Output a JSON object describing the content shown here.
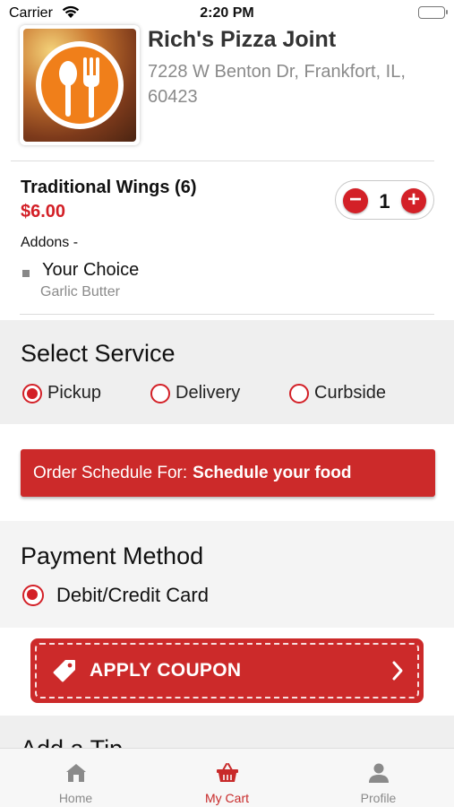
{
  "status_bar": {
    "carrier": "Carrier",
    "time": "2:20 PM"
  },
  "restaurant": {
    "name": "Rich's Pizza Joint",
    "address": "7228 W Benton Dr, Frankfort, IL, 60423",
    "logo_icon": "fork-spoon-icon"
  },
  "cart_item": {
    "name": "Traditional Wings (6)",
    "price": "$6.00",
    "quantity": "1",
    "addons_label": "Addons -",
    "addons": [
      {
        "name": "Your Choice",
        "value": "Garlic Butter"
      }
    ]
  },
  "service": {
    "title": "Select Service",
    "options": [
      {
        "label": "Pickup",
        "selected": true
      },
      {
        "label": "Delivery",
        "selected": false
      },
      {
        "label": "Curbside",
        "selected": false
      }
    ]
  },
  "schedule": {
    "prefix": "Order Schedule For:",
    "value": "Schedule your food"
  },
  "payment": {
    "title": "Payment Method",
    "options": [
      {
        "label": "Debit/Credit Card",
        "selected": true
      }
    ]
  },
  "coupon": {
    "label": "APPLY COUPON"
  },
  "tip": {
    "title": "Add a Tip"
  },
  "tabbar": {
    "tabs": [
      {
        "label": "Home",
        "icon": "home-icon",
        "active": false
      },
      {
        "label": "My Cart",
        "icon": "basket-icon",
        "active": true
      },
      {
        "label": "Profile",
        "icon": "person-icon",
        "active": false
      }
    ]
  },
  "colors": {
    "accent": "#d32027",
    "button": "#cc2a2a",
    "muted": "#8a8a8a"
  }
}
